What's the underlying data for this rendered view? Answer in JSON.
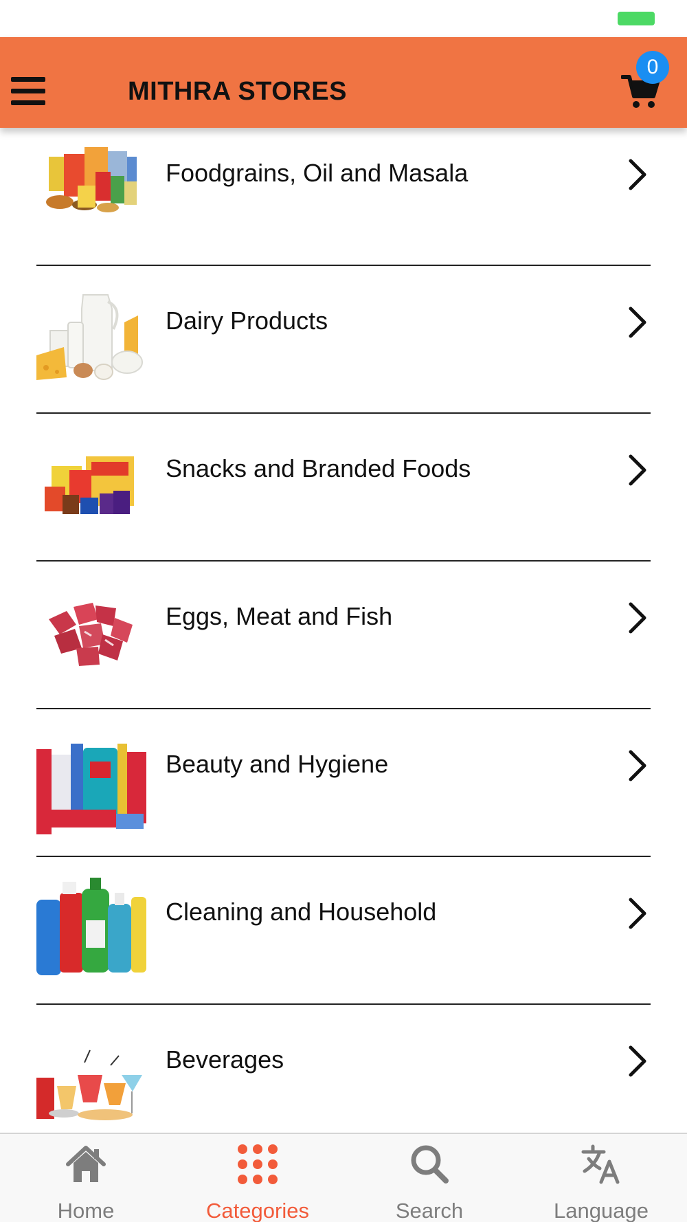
{
  "header": {
    "menu_icon": "hamburger-menu-icon",
    "title": "MITHRA STORES",
    "cart_icon": "shopping-cart-icon",
    "cart_count": "0",
    "background_color": "#f07443",
    "badge_color": "#1a8ef2"
  },
  "categories": [
    {
      "label": "Foodgrains, Oil and Masala",
      "image": "foodgrains-oil-masala-products",
      "chevron": "chevron-right-icon"
    },
    {
      "label": "Dairy Products",
      "image": "dairy-products",
      "chevron": "chevron-right-icon"
    },
    {
      "label": "Snacks and Branded Foods",
      "image": "snacks-branded-foods",
      "chevron": "chevron-right-icon"
    },
    {
      "label": "Eggs, Meat and Fish",
      "image": "raw-meat-cubes",
      "chevron": "chevron-right-icon"
    },
    {
      "label": "Beauty and Hygiene",
      "image": "toothpaste-mouthwash-products",
      "chevron": "chevron-right-icon"
    },
    {
      "label": "Cleaning and Household",
      "image": "cleaning-detergent-bottles",
      "chevron": "chevron-right-icon"
    },
    {
      "label": "Beverages",
      "image": "beverage-drinks-glasses",
      "chevron": "chevron-right-icon"
    }
  ],
  "tabs": [
    {
      "label": "Home",
      "icon": "home-icon",
      "active": false
    },
    {
      "label": "Categories",
      "icon": "dots-grid-icon",
      "active": true
    },
    {
      "label": "Search",
      "icon": "search-icon",
      "active": false
    },
    {
      "label": "Language",
      "icon": "translate-icon",
      "active": false
    }
  ],
  "colors": {
    "active_tab": "#f25b3a",
    "inactive_tab": "#7d7d7d",
    "battery": "#4cd964"
  }
}
